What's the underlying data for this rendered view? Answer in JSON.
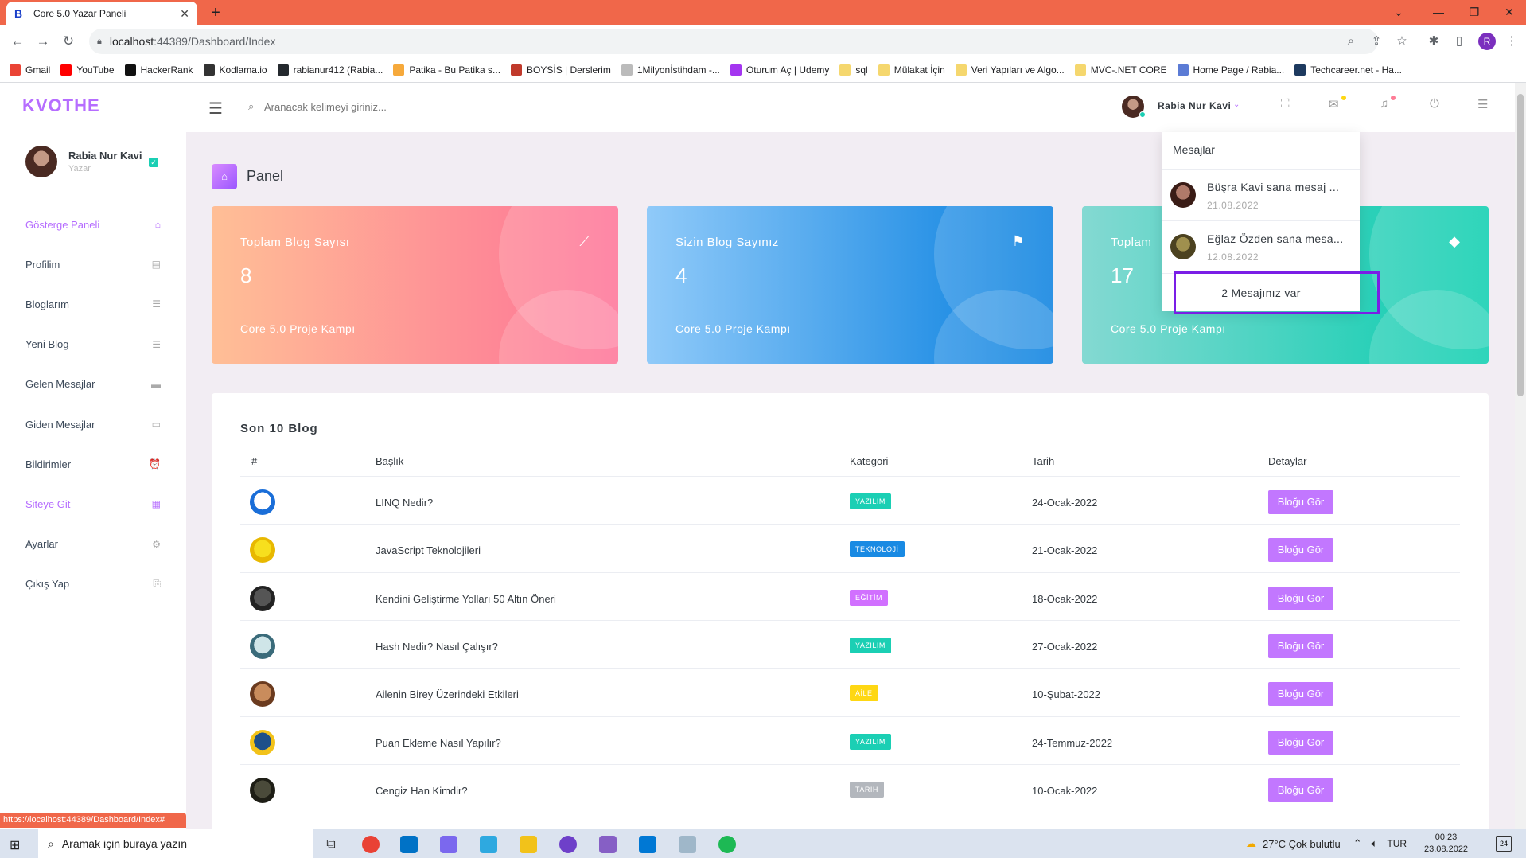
{
  "browser": {
    "tab_title": "Core 5.0 Yazar Paneli",
    "url_host": "localhost",
    "url_path": ":44389/Dashboard/Index",
    "bookmarks": [
      {
        "label": "Gmail",
        "color": "#ea4335"
      },
      {
        "label": "YouTube",
        "color": "#ff0000"
      },
      {
        "label": "HackerRank",
        "color": "#111111"
      },
      {
        "label": "Kodlama.io",
        "color": "#333333"
      },
      {
        "label": "rabianur412 (Rabia...",
        "color": "#24292e"
      },
      {
        "label": "Patika - Bu Patika s...",
        "color": "#f6a93b"
      },
      {
        "label": "BOYSİS | Derslerim",
        "color": "#c0392b"
      },
      {
        "label": "1Milyonİstihdam -...",
        "color": "#bbbbbb"
      },
      {
        "label": "Oturum Aç | Udemy",
        "color": "#a435f0"
      },
      {
        "label": "sql",
        "color": "#f5d76e"
      },
      {
        "label": "Mülakat İçin",
        "color": "#f5d76e"
      },
      {
        "label": "Veri Yapıları ve Algo...",
        "color": "#f5d76e"
      },
      {
        "label": "MVC-.NET CORE",
        "color": "#f5d76e"
      },
      {
        "label": "Home Page / Rabia...",
        "color": "#5b7bd5"
      },
      {
        "label": "Techcareer.net - Ha...",
        "color": "#1d3a5f"
      }
    ],
    "profile_letter": "R",
    "status_url": "https://localhost:44389/Dashboard/Index#"
  },
  "app": {
    "logo": "KVOTHE",
    "search_placeholder": "Aranacak kelimeyi giriniz...",
    "user_name": "Rabia Nur Kavi",
    "user_role": "Yazar",
    "menu": [
      {
        "label": "Gösterge Paneli",
        "icon": "home-icon",
        "glyph": "⌂",
        "active": true
      },
      {
        "label": "Profilim",
        "icon": "id-card-icon",
        "glyph": "▤",
        "active": false
      },
      {
        "label": "Bloglarım",
        "icon": "list-icon",
        "glyph": "☰",
        "active": false
      },
      {
        "label": "Yeni Blog",
        "icon": "list-icon",
        "glyph": "☰",
        "active": false
      },
      {
        "label": "Gelen Mesajlar",
        "icon": "message-icon",
        "glyph": "▬",
        "active": false
      },
      {
        "label": "Giden Mesajlar",
        "icon": "message-outline-icon",
        "glyph": "▭",
        "active": false
      },
      {
        "label": "Bildirimler",
        "icon": "alarm-icon",
        "glyph": "⏰",
        "active": false
      },
      {
        "label": "Siteye Git",
        "icon": "grid-icon",
        "glyph": "▦",
        "active": true
      },
      {
        "label": "Ayarlar",
        "icon": "gear-icon",
        "glyph": "⚙",
        "active": false
      },
      {
        "label": "Çıkış Yap",
        "icon": "logout-icon",
        "glyph": "⎘",
        "active": false
      }
    ]
  },
  "page": {
    "title": "Panel",
    "cards": [
      {
        "label": "Toplam Blog Sayısı",
        "value": "8",
        "sub": "Core 5.0 Proje Kampı",
        "icon": "chart-line-icon",
        "glyph": "⟋"
      },
      {
        "label": "Sizin Blog Sayınız",
        "value": "4",
        "sub": "Core 5.0 Proje Kampı",
        "icon": "bookmark-icon",
        "glyph": "⚑"
      },
      {
        "label": "Toplam",
        "value": "17",
        "sub": "Core 5.0 Proje Kampı",
        "icon": "diamond-icon",
        "glyph": "◆"
      }
    ],
    "table_title": "Son 10 Blog",
    "columns": [
      "#",
      "Başlık",
      "Kategori",
      "Tarih",
      "Detaylar"
    ],
    "rows": [
      {
        "title": "LINQ Nedir?",
        "category": "YAZILIM",
        "cat_color": "#1bcfb4",
        "date": "24-Ocak-2022",
        "img": "#ffffff",
        "img2": "#1a6ed8"
      },
      {
        "title": "JavaScript Teknolojileri",
        "category": "TEKNOLOJİ",
        "cat_color": "#198ae3",
        "date": "21-Ocak-2022",
        "img": "#f7df1e",
        "img2": "#e8b800"
      },
      {
        "title": "Kendini Geliştirme Yolları 50 Altın Öneri",
        "category": "EĞİTİM",
        "cat_color": "#d170ff",
        "date": "18-Ocak-2022",
        "img": "#555555",
        "img2": "#222222"
      },
      {
        "title": "Hash Nedir? Nasıl Çalışır?",
        "category": "YAZILIM",
        "cat_color": "#1bcfb4",
        "date": "27-Ocak-2022",
        "img": "#cfe5e8",
        "img2": "#3a6b7a"
      },
      {
        "title": "Ailenin Birey Üzerindeki Etkileri",
        "category": "AİLE",
        "cat_color": "#fed713",
        "date": "10-Şubat-2022",
        "img": "#c98c5c",
        "img2": "#6b3b1f"
      },
      {
        "title": "Puan Ekleme Nasıl Yapılır?",
        "category": "YAZILIM",
        "cat_color": "#1bcfb4",
        "date": "24-Temmuz-2022",
        "img": "#1e4f8a",
        "img2": "#f2c21a"
      },
      {
        "title": "Cengiz Han Kimdir?",
        "category": "TARİH",
        "cat_color": "#b3b7bd",
        "date": "10-Ocak-2022",
        "img": "#4a4a3a",
        "img2": "#1e1e16"
      }
    ],
    "row_button": "Bloğu Gör"
  },
  "dropdown": {
    "header": "Mesajlar",
    "messages": [
      {
        "text": "Büşra Kavi sana mesaj ...",
        "date": "21.08.2022",
        "av1": "#b07a6a",
        "av2": "#3a1c16"
      },
      {
        "text": "Eğlaz Özden sana mesa...",
        "date": "12.08.2022",
        "av1": "#a0904e",
        "av2": "#4c4220"
      }
    ],
    "footer": "2 Mesajınız var"
  },
  "taskbar": {
    "search_placeholder": "Aramak için buraya yazın",
    "weather": "27°C  Çok bulutlu",
    "lang": "TUR",
    "time": "00:23",
    "date": "23.08.2022",
    "notif_count": "24"
  }
}
